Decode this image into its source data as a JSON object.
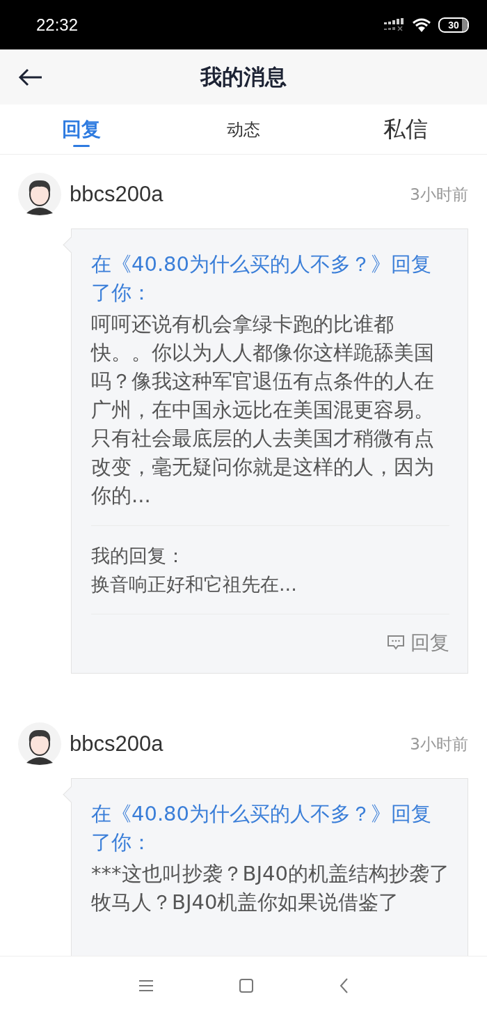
{
  "status_bar": {
    "time": "22:32",
    "battery": "30"
  },
  "header": {
    "title": "我的消息"
  },
  "tabs": [
    {
      "label": "回复",
      "selected": true
    },
    {
      "label": "动态",
      "selected": false
    },
    {
      "label": "私信",
      "selected": false
    }
  ],
  "messages": [
    {
      "user": "bbcs200a",
      "time": "3小时前",
      "context": "在《40.80为什么买的人不多？》回复了你：",
      "content": "呵呵还说有机会拿绿卡跑的比谁都快。。你以为人人都像你这样跪舔美国吗？像我这种军官退伍有点条件的人在广州，在中国永远比在美国混更容易。只有社会最底层的人去美国才稍微有点改变，毫无疑问你就是这样的人，因为你的...",
      "my_reply_label": "我的回复：",
      "my_reply": "换音响正好和它祖先在...",
      "reply_button": "回复"
    },
    {
      "user": "bbcs200a",
      "time": "3小时前",
      "context": "在《40.80为什么买的人不多？》回复了你：",
      "content": "***这也叫抄袭？BJ40的机盖结构抄袭了牧马人？BJ40机盖你如果说借鉴了"
    }
  ]
}
